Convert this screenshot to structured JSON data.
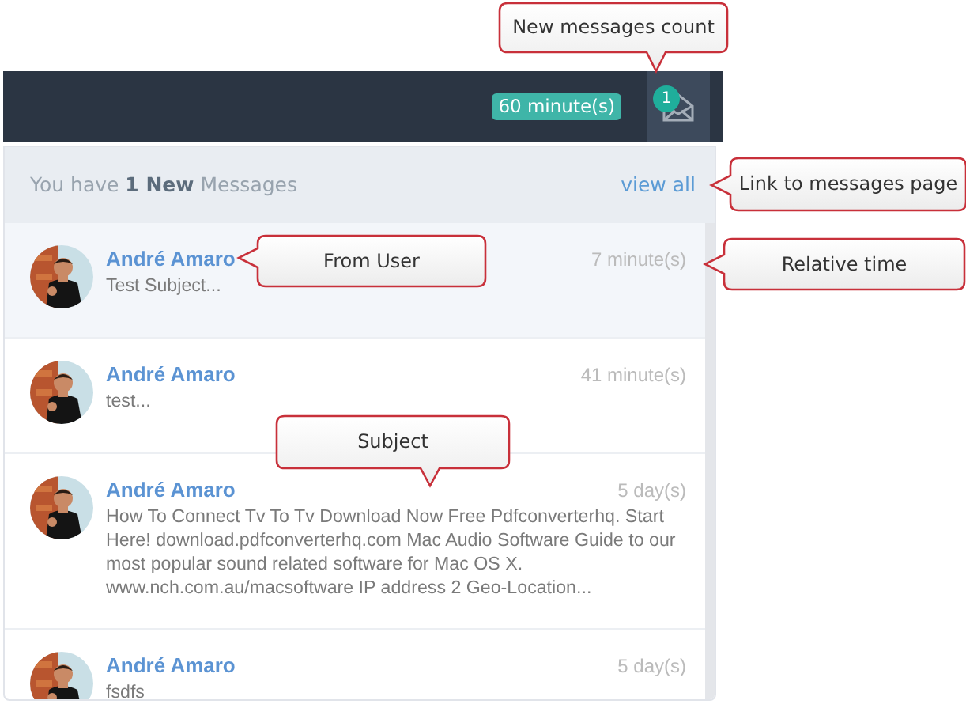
{
  "navbar": {
    "session_badge": "60 minute(s)",
    "messages_count": "1"
  },
  "dropdown": {
    "header": "You have **1 New** Messages",
    "view_all": "view all",
    "messages": [
      {
        "sender": "André Amaro",
        "time": "7 minute(s)",
        "subject": "Test Subject...",
        "unread": true
      },
      {
        "sender": "André Amaro",
        "time": "41 minute(s)",
        "subject": "test...",
        "unread": false
      },
      {
        "sender": "André Amaro",
        "time": "5 day(s)",
        "subject": "How To Connect Tv To Tv Download Now Free Pdfconverterhq. Start Here! download.pdfconverterhq.com Mac Audio Software Guide to our most popular sound related software for Mac OS X. www.nch.com.au/macsoftware IP address 2 Geo-Location...",
        "unread": false
      },
      {
        "sender": "André Amaro",
        "time": "5 day(s)",
        "subject": "fsdfs",
        "unread": false
      }
    ]
  },
  "callouts": [
    {
      "text": "New messages count",
      "kind": "downward"
    },
    {
      "text": "Link to messages page",
      "kind": "leftward"
    },
    {
      "text": "From User",
      "kind": "leftward"
    },
    {
      "text": "Relative time",
      "kind": "leftward"
    },
    {
      "text": "Subject",
      "kind": "downward"
    }
  ]
}
